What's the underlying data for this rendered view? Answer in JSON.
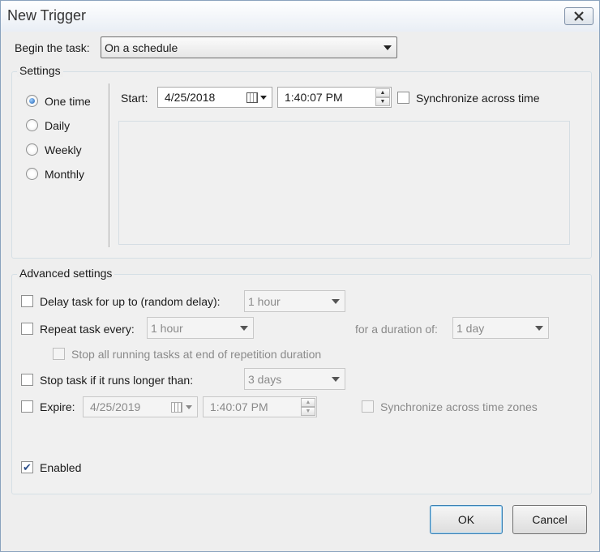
{
  "window": {
    "title": "New Trigger"
  },
  "begin": {
    "label": "Begin the task:",
    "value": "On a schedule"
  },
  "settings": {
    "title": "Settings",
    "radios": [
      "One time",
      "Daily",
      "Weekly",
      "Monthly"
    ],
    "selected": "One time",
    "start_label": "Start:",
    "start_date": "4/25/2018",
    "start_time": "1:40:07 PM",
    "sync_label": "Synchronize across time"
  },
  "advanced": {
    "title": "Advanced settings",
    "delay_label": "Delay task for up to (random delay):",
    "delay_value": "1 hour",
    "repeat_label": "Repeat task every:",
    "repeat_value": "1 hour",
    "duration_label": "for a duration of:",
    "duration_value": "1 day",
    "stop_all_label": "Stop all running tasks at end of repetition duration",
    "stop_label": "Stop task if it runs longer than:",
    "stop_value": "3 days",
    "expire_label": "Expire:",
    "expire_date": "4/25/2019",
    "expire_time": "1:40:07 PM",
    "sync_zones_label": "Synchronize across time zones",
    "enabled_label": "Enabled",
    "enabled_checked": true
  },
  "buttons": {
    "ok": "OK",
    "cancel": "Cancel"
  },
  "colors": {
    "accent": "#1f5fb0",
    "window_bg": "#eeeeee"
  },
  "icons": {
    "close": "close-icon",
    "calendar": "calendar-icon",
    "dropdown": "chevron-down-icon"
  }
}
